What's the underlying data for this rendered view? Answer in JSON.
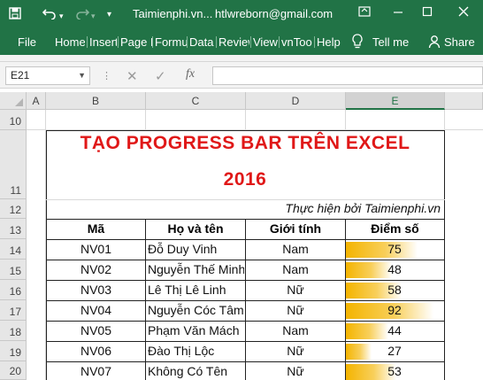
{
  "titlebar": {
    "document": "Taimienphi.vn...",
    "account": "htlwreborn@gmail.com",
    "save_icon": "save-icon",
    "undo_icon": "undo-icon",
    "redo_icon": "redo-icon",
    "customize_icon": "customize-qat-icon"
  },
  "tabs": [
    "File",
    "Home",
    "Insert",
    "Page L",
    "Formu",
    "Data",
    "Review",
    "View",
    "vnToo",
    "Help"
  ],
  "tell_me": "Tell me",
  "share": "Share",
  "namebox": "E21",
  "columns": [
    "A",
    "B",
    "C",
    "D",
    "E"
  ],
  "selected_column": "E",
  "rows": [
    "10",
    "11",
    "12",
    "13",
    "14",
    "15",
    "16",
    "17",
    "18",
    "19",
    "20"
  ],
  "sheet": {
    "title_line1": "TẠO PROGRESS BAR TRÊN EXCEL",
    "title_line2": "2016",
    "credit": "Thực hiện bởi Taimienphi.vn",
    "headers": {
      "ma": "Mã",
      "ho_ten": "Họ và tên",
      "gioi_tinh": "Giới tính",
      "diem": "Điểm số"
    },
    "records": [
      {
        "ma": "NV01",
        "ho_ten": "Đỗ Duy Vinh",
        "gioi_tinh": "Nam",
        "diem": 75
      },
      {
        "ma": "NV02",
        "ho_ten": "Nguyễn Thế Minh",
        "gioi_tinh": "Nam",
        "diem": 48
      },
      {
        "ma": "NV03",
        "ho_ten": "Lê Thị Lê Linh",
        "gioi_tinh": "Nữ",
        "diem": 58
      },
      {
        "ma": "NV04",
        "ho_ten": "Nguyễn Cóc Tâm",
        "gioi_tinh": "Nữ",
        "diem": 92
      },
      {
        "ma": "NV05",
        "ho_ten": "Phạm Văn Mách",
        "gioi_tinh": "Nam",
        "diem": 44
      },
      {
        "ma": "NV06",
        "ho_ten": "Đào Thị Lộc",
        "gioi_tinh": "Nữ",
        "diem": 27
      },
      {
        "ma": "NV07",
        "ho_ten": "Không Có Tên",
        "gioi_tinh": "Nữ",
        "diem": 53
      }
    ],
    "data_bar_max": 100,
    "data_bar_color": "#f4b400"
  },
  "colors": {
    "accent": "#217346",
    "title_red": "#e01818"
  }
}
